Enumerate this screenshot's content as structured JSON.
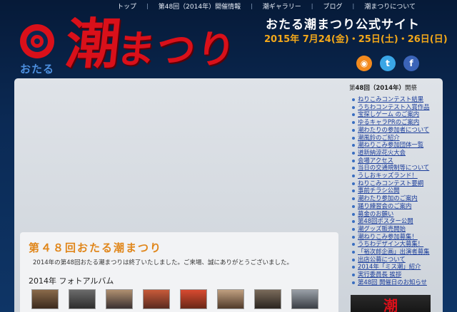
{
  "nav": {
    "items": [
      "トップ",
      "第48回（2014年）開催情報",
      "潮ギャラリー",
      "ブログ",
      "潮まつりについて"
    ],
    "separator": "|"
  },
  "logo": {
    "otaru": "おたる",
    "main": "潮",
    "kana": "まつり"
  },
  "header": {
    "site_title": "おたる潮まつり公式サイト",
    "date": "2015年 7月24(金)・25日(土)・26日(日)"
  },
  "social": {
    "rss": "rss-icon",
    "twitter": "twitter-icon",
    "facebook": "facebook-icon",
    "rss_glyph": "◉",
    "twitter_glyph": "t",
    "facebook_glyph": "f"
  },
  "sidebar": {
    "heading_prefix": "第",
    "heading_bold": "48回（2014年）",
    "heading_suffix": "開祭",
    "items": [
      "ねりこみコンテスト結果",
      "うちわコンテスト入賞作品",
      "宝探しゲーム のご案内",
      "ゆるキャラPRのご案内",
      "潮わたりの参加者について",
      "潮風鈴のご紹介",
      "潮ねりこみ参加団体一覧",
      "道新納涼花火大会",
      "会場アクセス",
      "当日の交通規制等について",
      "うしおキッズランド！",
      "ねりこみコンテスト要綱",
      "事前チラシ公開",
      "潮わたり参加のご案内",
      "踊り練習会のご案内",
      "募金のお願い",
      "第48回ポスター公開",
      "潮グッズ販売開始",
      "潮ねりこみ参加募集！",
      "うちわデザイン大募集！",
      "「裕次郎企画」出演者募集",
      "出店公募について",
      "2014年「ミス潮」紹介",
      "実行委員長 挨拶",
      "第48回 開催日のお知らせ"
    ],
    "banner": "潮"
  },
  "content": {
    "heading": "第４８回おたる潮まつり",
    "description": "2014年の第48回おたる潮まつりは終了いたしました。ご来場、誠にありがとうございました。",
    "album_title": "2014年 フォトアルバム",
    "thumbnails": [
      "photo-1",
      "photo-2",
      "photo-3",
      "photo-4",
      "photo-5",
      "photo-6",
      "photo-7",
      "photo-8"
    ]
  }
}
